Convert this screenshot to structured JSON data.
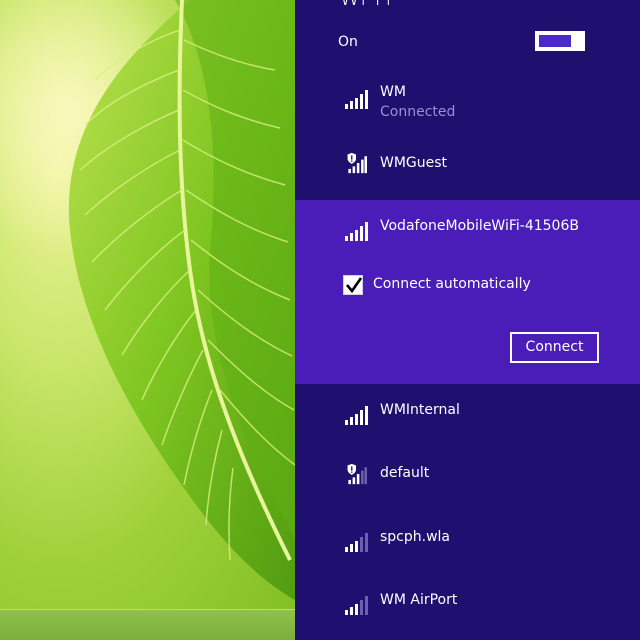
{
  "pane": {
    "title": "Wi-Fi",
    "toggle_label": "On",
    "toggle_state": "on"
  },
  "networks": [
    {
      "name": "WM",
      "status": "Connected",
      "secured_warning": false,
      "signal_bars": 5
    },
    {
      "name": "WMGuest",
      "status": "",
      "secured_warning": true,
      "signal_bars": 5
    },
    {
      "name": "VodafoneMobileWiFi-41506B",
      "status": "",
      "secured_warning": false,
      "signal_bars": 5
    },
    {
      "name": "WMInternal",
      "status": "",
      "secured_warning": false,
      "signal_bars": 5
    },
    {
      "name": "default",
      "status": "",
      "secured_warning": true,
      "signal_bars": 3
    },
    {
      "name": "spcph.wla",
      "status": "",
      "secured_warning": false,
      "signal_bars": 3
    },
    {
      "name": "WM AirPort",
      "status": "",
      "secured_warning": false,
      "signal_bars": 3
    }
  ],
  "expanded": {
    "checkbox_label": "Connect automatically",
    "checked": true,
    "connect_label": "Connect"
  },
  "colors": {
    "pane_bg": "#1f0f6e",
    "selected_bg": "#4a1cb8",
    "subtext": "#9a8fd6",
    "toggle_accent": "#4a2bc9"
  },
  "icons": {
    "signal": "wifi-signal-icon",
    "warning": "warning-shield-icon",
    "check": "checkmark-icon"
  }
}
